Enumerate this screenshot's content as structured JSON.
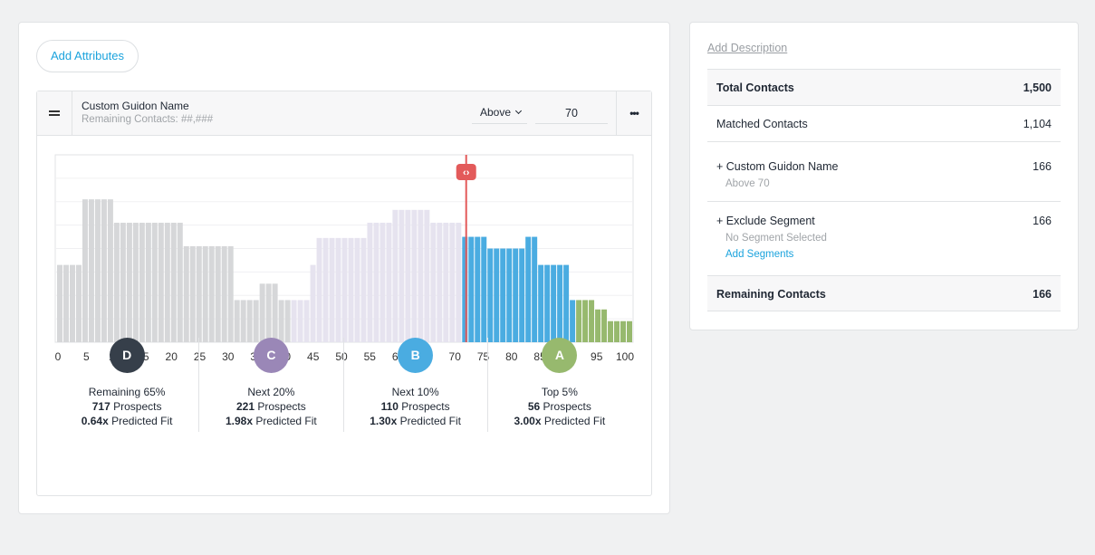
{
  "left": {
    "add_attributes_label": "Add Attributes",
    "attribute": {
      "title": "Custom Guidon Name",
      "subtitle": "Remaining Contacts: ##,###",
      "operator": "Above",
      "value": "70",
      "more_icon": "ellipsis-icon",
      "drag_icon": "drag-handle-icon"
    }
  },
  "chart_data": {
    "type": "bar",
    "title": "",
    "xlabel": "",
    "ylabel": "",
    "xlim": [
      0,
      100
    ],
    "ylim": [
      0,
      8
    ],
    "grid": true,
    "x_ticks": [
      0,
      5,
      10,
      15,
      20,
      25,
      30,
      35,
      40,
      45,
      50,
      55,
      60,
      65,
      70,
      75,
      80,
      85,
      90,
      95,
      100
    ],
    "threshold": 72,
    "threshold_icon": "drag-code-icon",
    "segments": [
      {
        "name": "D",
        "color": "#d6d7d9",
        "values": [
          3.3,
          3.3,
          3.3,
          3.3,
          6.1,
          6.1,
          6.1,
          6.1,
          6.1,
          5.1,
          5.1,
          5.1,
          5.1,
          5.1,
          5.1,
          5.1,
          5.1,
          5.1,
          5.1,
          5.1,
          4.1,
          4.1,
          4.1,
          4.1,
          4.1,
          4.1,
          4.1,
          4.1,
          1.8,
          1.8,
          1.8,
          1.8,
          2.5,
          2.5,
          2.5,
          1.8,
          1.8
        ]
      },
      {
        "name": "C",
        "color": "#e6e3ef",
        "values": [
          1.8,
          1.8,
          1.8,
          3.3,
          4.45,
          4.45,
          4.45,
          4.45,
          4.45,
          4.45,
          4.45,
          4.45,
          5.1,
          5.1,
          5.1,
          5.1,
          5.65,
          5.65,
          5.65,
          5.65,
          5.65,
          5.65,
          5.1,
          5.1,
          5.1,
          5.1,
          5.1
        ]
      },
      {
        "name": "B",
        "color": "#4aace1",
        "values": [
          4.5,
          4.5,
          4.5,
          4.5,
          4.0,
          4.0,
          4.0,
          4.0,
          4.0,
          4.0,
          4.5,
          4.5,
          3.3,
          3.3,
          3.3,
          3.3,
          3.3,
          1.8
        ]
      },
      {
        "name": "A",
        "color": "#97b96e",
        "values": [
          1.8,
          1.8,
          1.8,
          1.4,
          1.4,
          0.9,
          0.9,
          0.9,
          0.9
        ]
      }
    ]
  },
  "tiers": [
    {
      "letter": "D",
      "color": "#363f4a",
      "label": "Remaining 65%",
      "count": "717",
      "count_suffix": " Prospects",
      "fit": "0.64x",
      "fit_suffix": " Predicted Fit"
    },
    {
      "letter": "C",
      "color": "#9a87b7",
      "label": "Next 20%",
      "count": "221",
      "count_suffix": " Prospects",
      "fit": "1.98x",
      "fit_suffix": " Predicted Fit"
    },
    {
      "letter": "B",
      "color": "#4aace1",
      "label": "Next 10%",
      "count": "110",
      "count_suffix": " Prospects",
      "fit": "1.30x",
      "fit_suffix": " Predicted Fit"
    },
    {
      "letter": "A",
      "color": "#97b96e",
      "label": "Top 5%",
      "count": "56",
      "count_suffix": " Prospects",
      "fit": "3.00x",
      "fit_suffix": " Predicted Fit"
    }
  ],
  "right": {
    "add_description": "Add Description",
    "total": {
      "label": "Total Contacts",
      "value": "1,500"
    },
    "matched": {
      "label": "Matched Contacts",
      "value": "1,104"
    },
    "attribute": {
      "label": "+ Custom Guidon Name",
      "value": "166",
      "detail": "Above 70"
    },
    "exclude": {
      "label": "+ Exclude Segment",
      "value": "166",
      "detail": "No Segment Selected",
      "link": "Add Segments"
    },
    "remaining": {
      "label": "Remaining Contacts",
      "value": "166"
    }
  }
}
